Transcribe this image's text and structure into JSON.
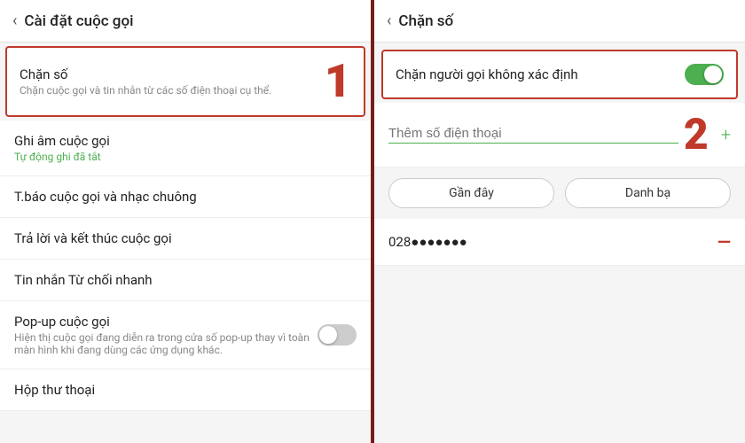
{
  "left_panel": {
    "header": {
      "back_label": "‹",
      "title": "Cài đặt cuộc gọi"
    },
    "items": [
      {
        "title": "Chặn số",
        "subtitle": "Chặn cuộc gọi và tin nhắn từ các số điện thoại cụ thể.",
        "highlighted": true,
        "step": "1"
      },
      {
        "title": "Ghi âm cuộc gọi",
        "subtitle": "Tự động ghi đã tắt",
        "subtitle_color": "green",
        "highlighted": false
      },
      {
        "title": "T.báo cuộc gọi và nhạc chuông",
        "highlighted": false
      },
      {
        "title": "Trả lời và kết thúc cuộc gọi",
        "highlighted": false
      },
      {
        "title": "Tin nhắn Từ chối nhanh",
        "highlighted": false
      },
      {
        "title": "Pop-up cuộc gọi",
        "subtitle": "Hiện thị cuộc gọi đang diễn ra trong cửa số pop-up thay vì toàn màn hình khi đang dùng các ứng dụng khác.",
        "has_toggle": true,
        "highlighted": false
      },
      {
        "title": "Hộp thư thoại",
        "highlighted": false
      }
    ]
  },
  "right_panel": {
    "header": {
      "back_label": "‹",
      "title": "Chặn số"
    },
    "block_unknown": {
      "label": "Chặn người gọi không xác định",
      "toggle_on": true
    },
    "add_phone": {
      "placeholder": "Thêm số điện thoại",
      "plus_label": "+",
      "step": "2"
    },
    "buttons": [
      {
        "label": "Gần đây"
      },
      {
        "label": "Danh bạ"
      }
    ],
    "blocked_numbers": [
      {
        "number": "028●●●●●●●"
      }
    ]
  }
}
